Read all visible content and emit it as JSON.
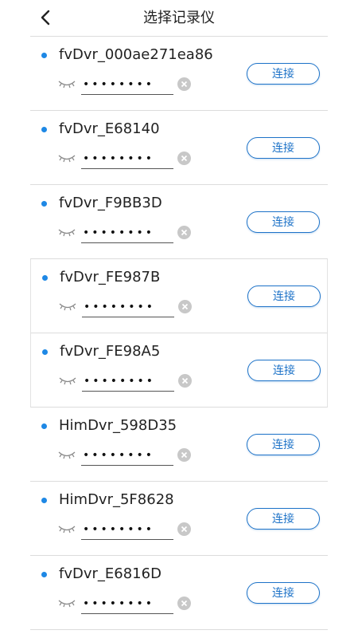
{
  "header": {
    "title": "选择记录仪",
    "back_icon": "chevron-left-icon"
  },
  "colors": {
    "accent": "#1e73c8",
    "dot": "#1e88e5",
    "divider": "#dcdcdc",
    "clear_bg": "#c8c8c8"
  },
  "devices": [
    {
      "name": "fvDvr_000ae271ea86",
      "password": "12345678",
      "connect_label": "连接"
    },
    {
      "name": "fvDvr_E68140",
      "password": "12345678",
      "connect_label": "连接"
    },
    {
      "name": "fvDvr_F9BB3D",
      "password": "12345678",
      "connect_label": "连接"
    },
    {
      "name": "fvDvr_FE987B",
      "password": "12345678",
      "connect_label": "连接"
    },
    {
      "name": "fvDvr_FE98A5",
      "password": "12345678",
      "connect_label": "连接"
    },
    {
      "name": "HimDvr_598D35",
      "password": "12345678",
      "connect_label": "连接"
    },
    {
      "name": "HimDvr_5F8628",
      "password": "12345678",
      "connect_label": "连接"
    },
    {
      "name": "fvDvr_E6816D",
      "password": "12345678",
      "connect_label": "连接"
    }
  ]
}
